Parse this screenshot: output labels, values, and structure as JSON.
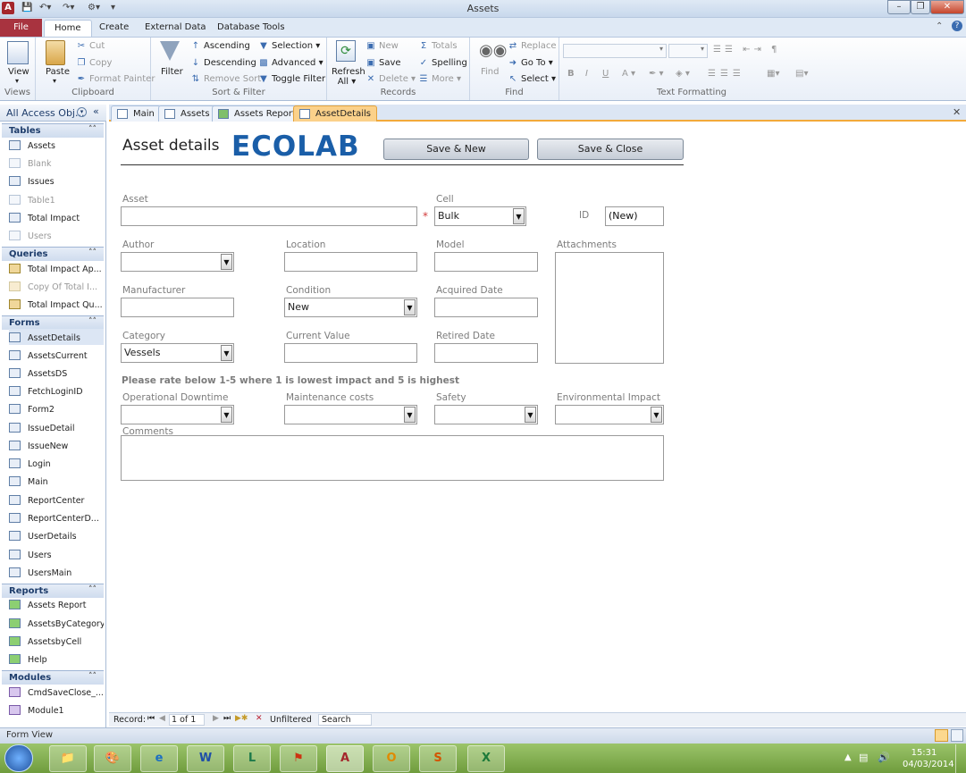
{
  "window": {
    "title": "Assets"
  },
  "quick_access": {
    "app_icon": "A",
    "save_icon": "save-icon",
    "undo_icon": "undo-icon",
    "redo_icon": "redo-icon"
  },
  "ribbon_tabs": [
    "File",
    "Home",
    "Create",
    "External Data",
    "Database Tools"
  ],
  "ribbon": {
    "views": {
      "view": "View",
      "label": "Views"
    },
    "clipboard": {
      "paste": "Paste",
      "cut": "Cut",
      "copy": "Copy",
      "format_painter": "Format Painter",
      "label": "Clipboard"
    },
    "sort_filter": {
      "filter": "Filter",
      "ascending": "Ascending",
      "descending": "Descending",
      "remove_sort": "Remove Sort",
      "selection": "Selection ▾",
      "advanced": "Advanced ▾",
      "toggle_filter": "Toggle Filter",
      "label": "Sort & Filter"
    },
    "records": {
      "refresh_all": "Refresh All ▾",
      "new": "New",
      "save": "Save",
      "delete": "Delete ▾",
      "totals": "Totals",
      "spelling": "Spelling",
      "more": "More ▾",
      "label": "Records"
    },
    "find": {
      "find": "Find",
      "replace": "Replace",
      "goto": "Go To ▾",
      "select": "Select ▾",
      "label": "Find"
    },
    "text_formatting": {
      "label": "Text Formatting"
    }
  },
  "nav": {
    "header": "All Access Obj...",
    "groups": [
      {
        "title": "Tables",
        "items": [
          {
            "label": "Assets",
            "disabled": false
          },
          {
            "label": "Blank",
            "disabled": true
          },
          {
            "label": "Issues",
            "disabled": false
          },
          {
            "label": "Table1",
            "disabled": true
          },
          {
            "label": "Total Impact",
            "disabled": false
          },
          {
            "label": "Users",
            "disabled": true
          }
        ]
      },
      {
        "title": "Queries",
        "items": [
          {
            "label": "Total Impact Ap...",
            "disabled": false
          },
          {
            "label": "Copy Of Total I...",
            "disabled": true
          },
          {
            "label": "Total Impact Qu...",
            "disabled": false
          }
        ]
      },
      {
        "title": "Forms",
        "items": [
          {
            "label": "AssetDetails",
            "disabled": false
          },
          {
            "label": "AssetsCurrent",
            "disabled": false
          },
          {
            "label": "AssetsDS",
            "disabled": false
          },
          {
            "label": "FetchLoginID",
            "disabled": false
          },
          {
            "label": "Form2",
            "disabled": false
          },
          {
            "label": "IssueDetail",
            "disabled": false
          },
          {
            "label": "IssueNew",
            "disabled": false
          },
          {
            "label": "Login",
            "disabled": false
          },
          {
            "label": "Main",
            "disabled": false
          },
          {
            "label": "ReportCenter",
            "disabled": false
          },
          {
            "label": "ReportCenterD...",
            "disabled": false
          },
          {
            "label": "UserDetails",
            "disabled": false
          },
          {
            "label": "Users",
            "disabled": false
          },
          {
            "label": "UsersMain",
            "disabled": false
          }
        ]
      },
      {
        "title": "Reports",
        "items": [
          {
            "label": "Assets Report",
            "disabled": false
          },
          {
            "label": "AssetsByCategory",
            "disabled": false
          },
          {
            "label": "AssetsbyCell",
            "disabled": false
          },
          {
            "label": "Help",
            "disabled": false
          }
        ]
      },
      {
        "title": "Modules",
        "items": [
          {
            "label": "CmdSaveClose_...",
            "disabled": false
          },
          {
            "label": "Module1",
            "disabled": false
          }
        ]
      }
    ]
  },
  "doc_tabs": [
    "Main",
    "Assets",
    "Assets Report",
    "AssetDetails"
  ],
  "form": {
    "title": "Asset details",
    "logo": "ECOLAB",
    "save_new": "Save & New",
    "save_close": "Save & Close",
    "asset": {
      "label": "Asset",
      "value": ""
    },
    "required_mark": "*",
    "cell": {
      "label": "Cell",
      "value": "Bulk"
    },
    "id": {
      "label": "ID",
      "value": "(New)"
    },
    "author": {
      "label": "Author",
      "value": ""
    },
    "location": {
      "label": "Location",
      "value": ""
    },
    "model": {
      "label": "Model",
      "value": ""
    },
    "attachments": {
      "label": "Attachments"
    },
    "manufacturer": {
      "label": "Manufacturer",
      "value": ""
    },
    "condition": {
      "label": "Condition",
      "value": "New"
    },
    "acquired_date": {
      "label": "Acquired Date",
      "value": ""
    },
    "category": {
      "label": "Category",
      "value": "Vessels"
    },
    "current_value": {
      "label": "Current Value",
      "value": ""
    },
    "retired_date": {
      "label": "Retired Date",
      "value": ""
    },
    "rating_note": "Please rate below 1-5 where 1 is lowest impact and 5 is highest",
    "operational_downtime": {
      "label": "Operational Downtime",
      "value": ""
    },
    "maintenance_costs": {
      "label": "Maintenance costs",
      "value": ""
    },
    "safety": {
      "label": "Safety",
      "value": ""
    },
    "environmental_impact": {
      "label": "Environmental Impact",
      "value": ""
    },
    "comments": {
      "label": "Comments",
      "value": ""
    }
  },
  "record_nav": {
    "label": "Record:",
    "position": "1 of 1",
    "filter": "Unfiltered",
    "search": "Search"
  },
  "status": {
    "text": "Form View"
  },
  "taskbar": {
    "apps": [
      "W",
      "L",
      "A",
      "O",
      "S",
      "X"
    ],
    "time": "15:31",
    "date": "04/03/2014"
  }
}
